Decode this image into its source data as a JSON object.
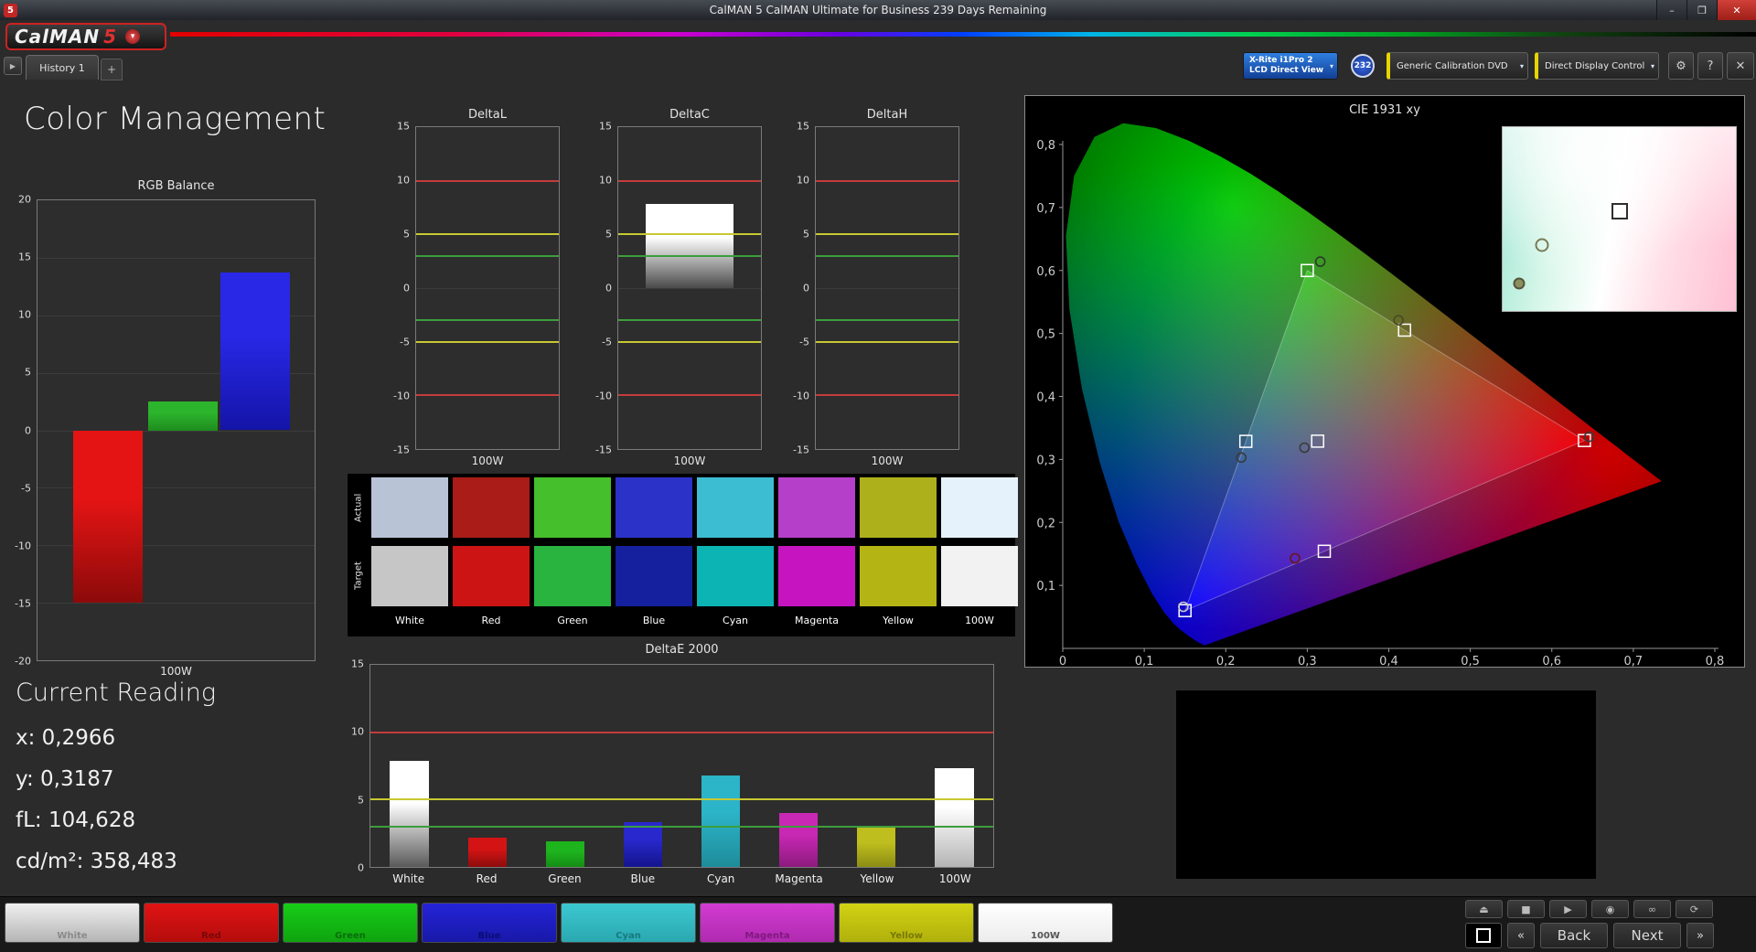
{
  "titlebar": {
    "icon": "5",
    "title": "CalMAN 5 CalMAN Ultimate for Business 239 Days Remaining",
    "minimize": "–",
    "maximize": "❐",
    "close": "✕"
  },
  "header": {
    "logo_text": "CalMAN",
    "logo_number": "5",
    "logo_arrow": "▾",
    "nav_arrow": "▶",
    "tab": "History 1",
    "add_tab": "+"
  },
  "toolbar": {
    "meter_line1": "X-Rite i1Pro 2",
    "meter_line2": "LCD Direct View",
    "meter_arrow": "▾",
    "badge": "232",
    "source_label": "Generic Calibration DVD",
    "source_arrow": "▾",
    "display_label": "Direct Display Control",
    "display_arrow": "▾",
    "gear": "⚙",
    "help": "?",
    "close": "✕"
  },
  "page_title": "Color Management",
  "current_reading": {
    "heading": "Current Reading",
    "lines": [
      "x: 0,2966",
      "y: 0,3187",
      "fL: 104,628",
      "cd/m²: 358,483"
    ]
  },
  "swatch_table": {
    "row_labels": [
      "Actual",
      "Target"
    ],
    "columns": [
      "White",
      "Red",
      "Green",
      "Blue",
      "Cyan",
      "Magenta",
      "Yellow",
      "100W"
    ],
    "actual_colors": [
      "#b9c3d6",
      "#a91c17",
      "#45bf2b",
      "#2b32c8",
      "#3dbdd2",
      "#b63fc9",
      "#aeb01b",
      "#e6f2fb"
    ],
    "target_colors": [
      "#c6c6c6",
      "#cd1414",
      "#28b43e",
      "#14209e",
      "#0cb4b4",
      "#c615c0",
      "#b4b414",
      "#f2f2f2"
    ]
  },
  "chart_data": [
    {
      "type": "bar",
      "variant": "grouped",
      "title": "RGB Balance",
      "xlabel": "100W",
      "categories": [
        "100W"
      ],
      "series": [
        {
          "name": "Red",
          "values": [
            -15.0
          ],
          "colors": [
            "#e41414",
            "#8c0a0a"
          ]
        },
        {
          "name": "Green",
          "values": [
            2.5
          ],
          "colors": [
            "#2cb42c",
            "#1e8c1e"
          ]
        },
        {
          "name": "Blue",
          "values": [
            13.7
          ],
          "colors": [
            "#2828e6",
            "#1414a8"
          ]
        }
      ],
      "ylim": [
        -20,
        20
      ],
      "yticks": [
        20,
        15,
        10,
        5,
        0,
        -5,
        -10,
        -15,
        -20
      ]
    },
    {
      "type": "bar",
      "variant": "mini",
      "title": "DeltaL",
      "xlabel": "100W",
      "categories": [
        "100W"
      ],
      "values": [
        null
      ],
      "ylim": [
        -15,
        15
      ],
      "yticks": [
        15,
        10,
        5,
        0,
        -5,
        -10,
        -15
      ],
      "reference_lines": [
        {
          "value": 10,
          "color": "#c43c3c"
        },
        {
          "value": 5,
          "color": "#c8c832"
        },
        {
          "value": 3,
          "color": "#3c9e3c"
        },
        {
          "value": -3,
          "color": "#3c9e3c"
        },
        {
          "value": -5,
          "color": "#c8c832"
        },
        {
          "value": -10,
          "color": "#c43c3c"
        }
      ]
    },
    {
      "type": "bar",
      "variant": "mini",
      "title": "DeltaC",
      "xlabel": "100W",
      "categories": [
        "100W"
      ],
      "values": [
        7.8
      ],
      "bar_colors": [
        "#ffffff",
        "#4a4a4a"
      ],
      "ylim": [
        -15,
        15
      ],
      "yticks": [
        15,
        10,
        5,
        0,
        -5,
        -10,
        -15
      ],
      "reference_lines": [
        {
          "value": 10,
          "color": "#c43c3c"
        },
        {
          "value": 5,
          "color": "#c8c832"
        },
        {
          "value": 3,
          "color": "#3c9e3c"
        },
        {
          "value": -3,
          "color": "#3c9e3c"
        },
        {
          "value": -5,
          "color": "#c8c832"
        },
        {
          "value": -10,
          "color": "#c43c3c"
        }
      ]
    },
    {
      "type": "bar",
      "variant": "mini",
      "title": "DeltaH",
      "xlabel": "100W",
      "categories": [
        "100W"
      ],
      "values": [
        null
      ],
      "ylim": [
        -15,
        15
      ],
      "yticks": [
        15,
        10,
        5,
        0,
        -5,
        -10,
        -15
      ],
      "reference_lines": [
        {
          "value": 10,
          "color": "#c43c3c"
        },
        {
          "value": 5,
          "color": "#c8c832"
        },
        {
          "value": 3,
          "color": "#3c9e3c"
        },
        {
          "value": -3,
          "color": "#3c9e3c"
        },
        {
          "value": -5,
          "color": "#c8c832"
        },
        {
          "value": -10,
          "color": "#c43c3c"
        }
      ]
    },
    {
      "type": "bar",
      "variant": "categories",
      "title": "DeltaE 2000",
      "categories": [
        "White",
        "Red",
        "Green",
        "Blue",
        "Cyan",
        "Magenta",
        "Yellow",
        "100W"
      ],
      "values": [
        7.9,
        2.2,
        1.9,
        3.3,
        6.8,
        4.0,
        3.0,
        7.3
      ],
      "bar_colors": [
        [
          "#ffffff",
          "#5a5a5a"
        ],
        [
          "#d41414",
          "#8c0c0c"
        ],
        [
          "#1eb41e",
          "#148c14"
        ],
        [
          "#2828cc",
          "#14148c"
        ],
        [
          "#2cb4c8",
          "#1e8c9a"
        ],
        [
          "#c828b4",
          "#8c1a7e"
        ],
        [
          "#bebe1e",
          "#8c8c14"
        ],
        [
          "#ffffff",
          "#b4b4b4"
        ]
      ],
      "ylim": [
        0,
        15
      ],
      "yticks": [
        15,
        10,
        5,
        0
      ],
      "reference_lines": [
        {
          "value": 10,
          "color": "#c43c3c"
        },
        {
          "value": 5,
          "color": "#c8c832"
        },
        {
          "value": 3,
          "color": "#3c9e3c"
        }
      ]
    },
    {
      "type": "scatter",
      "variant": "cie",
      "title": "CIE 1931 xy",
      "xlim": [
        0,
        0.8
      ],
      "ylim": [
        0,
        0.87
      ],
      "xticks": [
        "0",
        "0,1",
        "0,2",
        "0,3",
        "0,4",
        "0,5",
        "0,6",
        "0,7",
        "0,8"
      ],
      "yticks": [
        "0,1",
        "0,2",
        "0,3",
        "0,4",
        "0,5",
        "0,6",
        "0,7",
        "0,8"
      ],
      "gamut_triangle": [
        [
          0.64,
          0.33
        ],
        [
          0.3,
          0.6
        ],
        [
          0.15,
          0.06
        ]
      ],
      "points": [
        {
          "name": "White",
          "target": [
            0.3127,
            0.329
          ],
          "actual": [
            0.2966,
            0.3187
          ],
          "ring": "#3a3a3a"
        },
        {
          "name": "Red",
          "target": [
            0.64,
            0.33
          ],
          "actual": [
            0.646,
            0.336
          ],
          "ring": "#3a3a3a"
        },
        {
          "name": "Green",
          "target": [
            0.3,
            0.6
          ],
          "actual": [
            0.316,
            0.614
          ],
          "ring": "#2a3a2a"
        },
        {
          "name": "Blue",
          "target": [
            0.15,
            0.06
          ],
          "actual": [
            0.148,
            0.066
          ],
          "ring": "#c8c8c8"
        },
        {
          "name": "Cyan",
          "target": [
            0.2246,
            0.3287
          ],
          "actual": [
            0.219,
            0.303
          ],
          "ring": "#3a3a3a"
        },
        {
          "name": "Magenta",
          "target": [
            0.3209,
            0.1542
          ],
          "actual": [
            0.285,
            0.143
          ],
          "ring": "#6e1414"
        },
        {
          "name": "Yellow",
          "target": [
            0.4193,
            0.5053
          ],
          "actual": [
            0.412,
            0.521
          ],
          "ring": "#4a4a20"
        }
      ],
      "inset": {
        "square": {
          "x": 50,
          "y": 46
        },
        "circles": [
          {
            "x": 17,
            "y": 64
          },
          {
            "x": 7,
            "y": 85
          }
        ]
      }
    }
  ],
  "bottom_bar": {
    "swatches": [
      {
        "label": "White",
        "top": "#f0f0f0",
        "bottom": "#b4b4b4",
        "text": "#8a8a8a"
      },
      {
        "label": "Red",
        "top": "#e01414",
        "bottom": "#b40c0c",
        "text": "#7a0808"
      },
      {
        "label": "Green",
        "top": "#17cc17",
        "bottom": "#0fa40f",
        "text": "#0a6e0a"
      },
      {
        "label": "Blue",
        "top": "#2424d8",
        "bottom": "#1818a8",
        "text": "#0c0c78"
      },
      {
        "label": "Cyan",
        "top": "#3cc8d0",
        "bottom": "#2aa8b0",
        "text": "#177880"
      },
      {
        "label": "Magenta",
        "top": "#d23cd2",
        "bottom": "#b02ab0",
        "text": "#801880"
      },
      {
        "label": "Yellow",
        "top": "#d2d214",
        "bottom": "#b0b00c",
        "text": "#787808"
      },
      {
        "label": "100W",
        "top": "#ffffff",
        "bottom": "#ececec",
        "text": "#555555"
      }
    ],
    "transport": [
      {
        "name": "eject-button",
        "glyph": "⏏"
      },
      {
        "name": "stop-button",
        "glyph": "■"
      },
      {
        "name": "play-button",
        "glyph": "▶"
      },
      {
        "name": "disc-button",
        "glyph": "◉"
      },
      {
        "name": "loop-button",
        "glyph": "∞"
      },
      {
        "name": "refresh-button",
        "glyph": "⟳"
      }
    ],
    "back_chevron": "«",
    "back": "Back",
    "next": "Next",
    "next_chevron": "»"
  }
}
